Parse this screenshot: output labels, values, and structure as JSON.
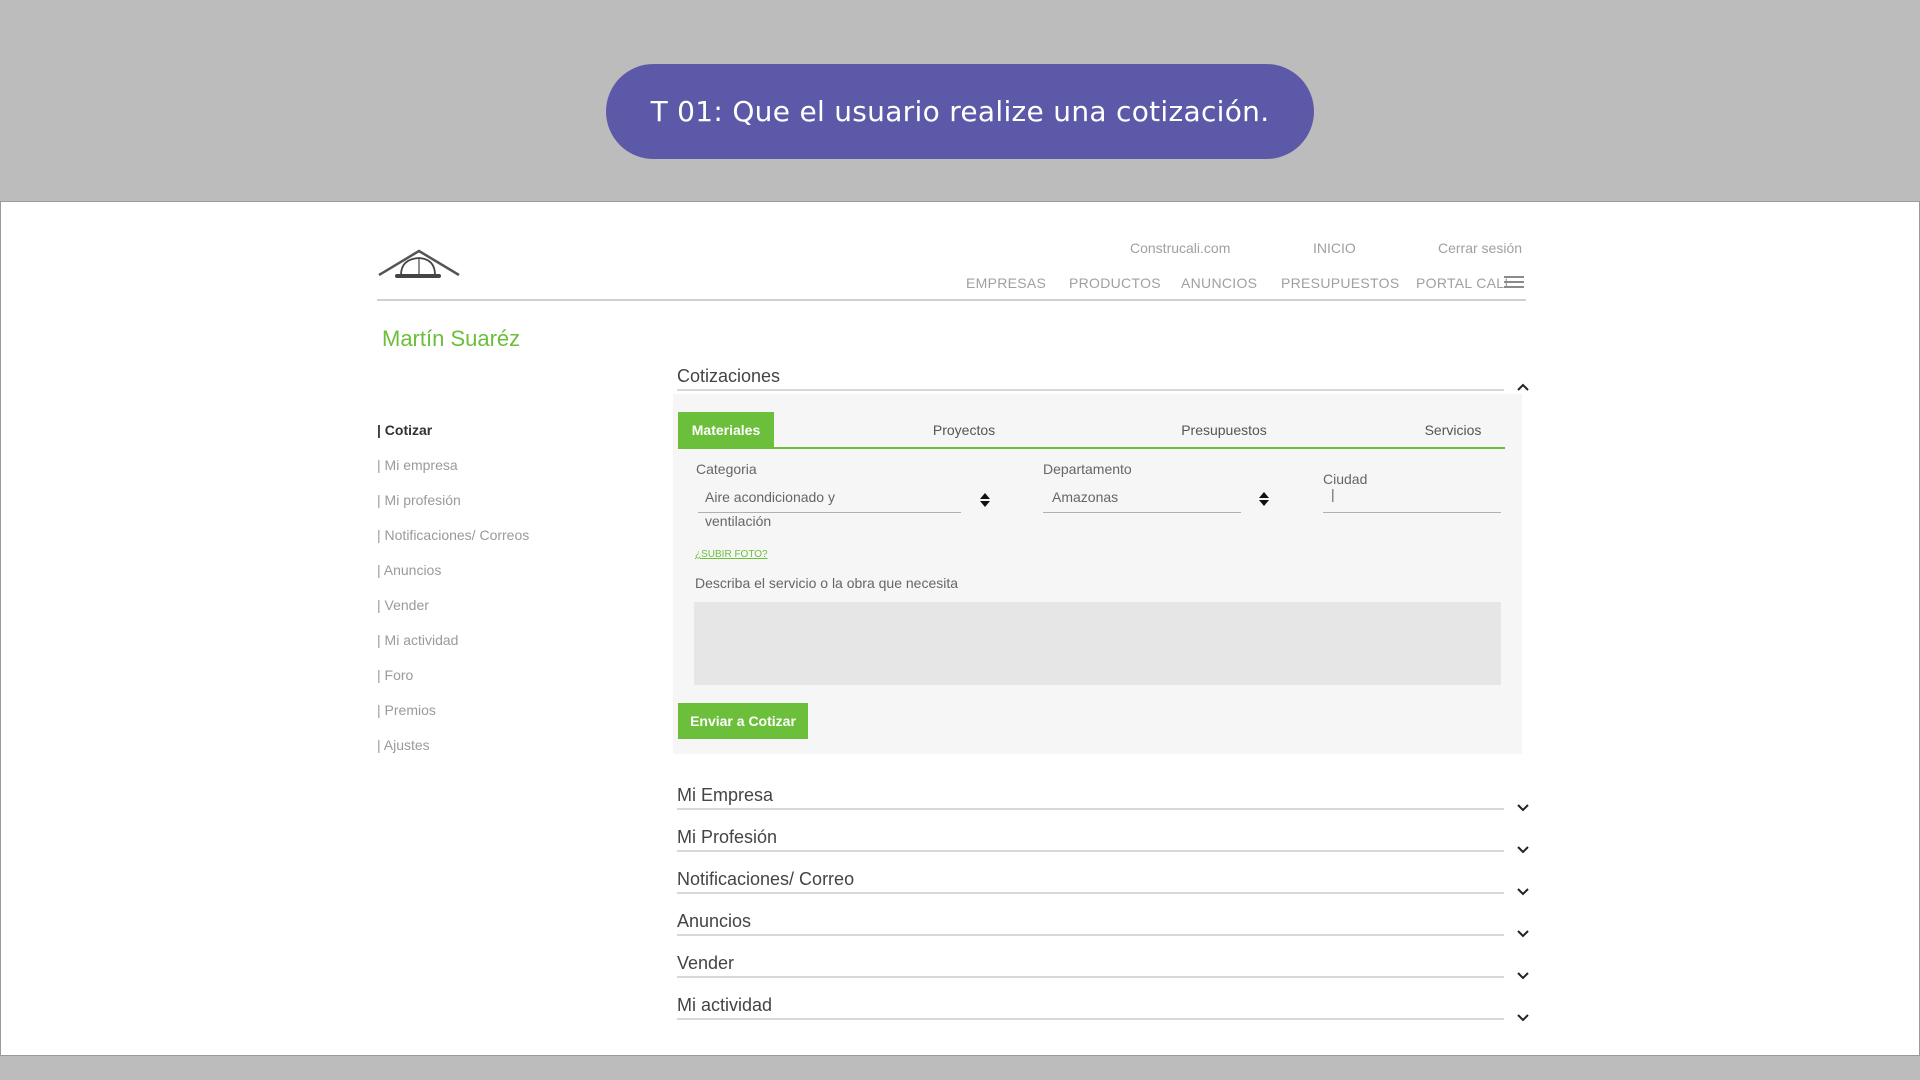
{
  "task_banner": "T 01: Que el usuario realize una cotización.",
  "header": {
    "top_links": [
      "Construcali.com",
      "INICIO",
      "Cerrar sesión"
    ],
    "nav": [
      "EMPRESAS",
      "PRODUCTOS",
      "ANUNCIOS",
      "PRESUPUESTOS",
      "PORTAL CALI"
    ]
  },
  "user_name": "Martín Suaréz",
  "sidebar": {
    "active_index": 0,
    "items": [
      "| Cotizar",
      "| Mi empresa",
      "| Mi profesión",
      "| Notificaciones/ Correos",
      "| Anuncios",
      "| Vender",
      "| Mi actividad",
      "| Foro",
      "| Premios",
      "| Ajustes"
    ]
  },
  "cotizaciones": {
    "title": "Cotizaciones",
    "expanded": true,
    "tabs": [
      "Materiales",
      "Proyectos",
      "Presupuestos",
      "Servicios"
    ],
    "active_tab": "Materiales",
    "categoria": {
      "label": "Categoria",
      "value_line1": "Aire acondicionado y",
      "value_line2": "ventilación"
    },
    "departamento": {
      "label": "Departamento",
      "value": "Amazonas"
    },
    "ciudad": {
      "label": "Ciudad",
      "value": "|"
    },
    "photo_link": "¿SUBIR FOTO?",
    "description_label": "Describa el servicio o la obra que necesita",
    "description_value": "",
    "submit_label": "Enviar a Cotizar"
  },
  "collapsed_sections": [
    "Mi Empresa",
    "Mi Profesión",
    "Notificaciones/ Correo",
    "Anuncios",
    "Vender",
    "Mi actividad"
  ],
  "colors": {
    "accent": "#6cbf3a",
    "banner": "#5c59a8",
    "backdrop": "#bcbcbc"
  },
  "icons": [
    "logo-hardhat-roof",
    "hamburger-icon",
    "chevron-up-icon",
    "chevron-down-icon",
    "up-down-arrows-icon"
  ]
}
